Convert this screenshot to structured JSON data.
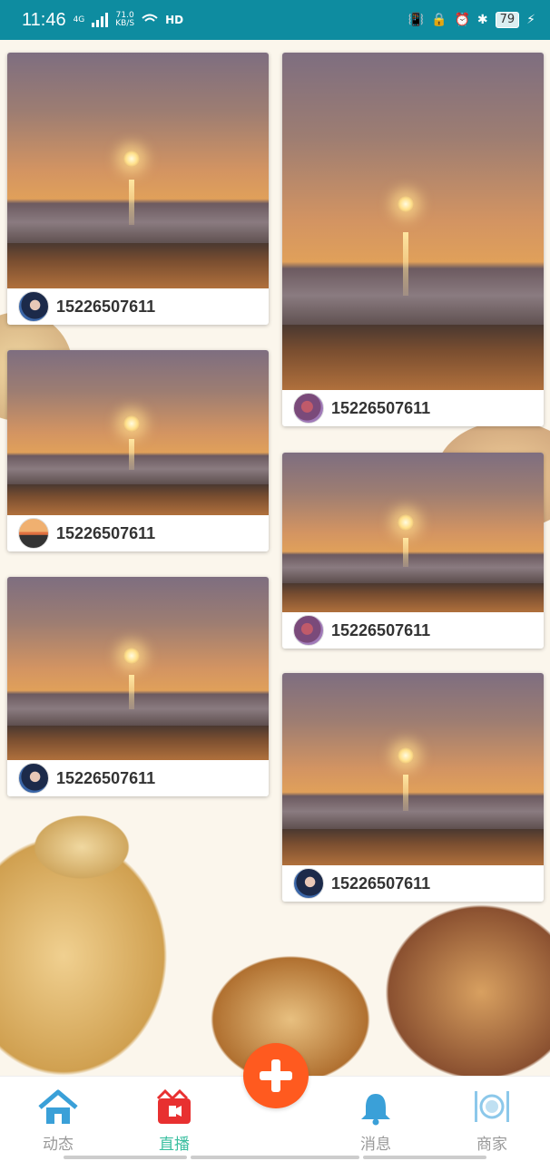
{
  "status_bar": {
    "time": "11:46",
    "network": "4G",
    "speed_value": "71.0",
    "speed_unit": "KB/S",
    "hd": "HD",
    "battery": "79"
  },
  "feed": {
    "cards": [
      {
        "username": "15226507611",
        "avatar": "av-blue"
      },
      {
        "username": "15226507611",
        "avatar": "av-purple"
      },
      {
        "username": "15226507611",
        "avatar": "av-sunset"
      },
      {
        "username": "15226507611",
        "avatar": "av-purple"
      },
      {
        "username": "15226507611",
        "avatar": "av-blue"
      },
      {
        "username": "15226507611",
        "avatar": "av-blue"
      }
    ]
  },
  "nav": {
    "items": [
      {
        "label": "动态",
        "icon": "home-icon",
        "active": false
      },
      {
        "label": "直播",
        "icon": "live-video-icon",
        "active": true
      },
      {
        "label": "消息",
        "icon": "bell-icon",
        "active": false
      },
      {
        "label": "商家",
        "icon": "dining-icon",
        "active": false
      }
    ],
    "add_icon": "plus-icon"
  },
  "colors": {
    "status_bar": "#0e8ca0",
    "active_tab": "#3bbfa0",
    "add_button": "#ff5a1f",
    "home_icon": "#3aa0d8"
  }
}
